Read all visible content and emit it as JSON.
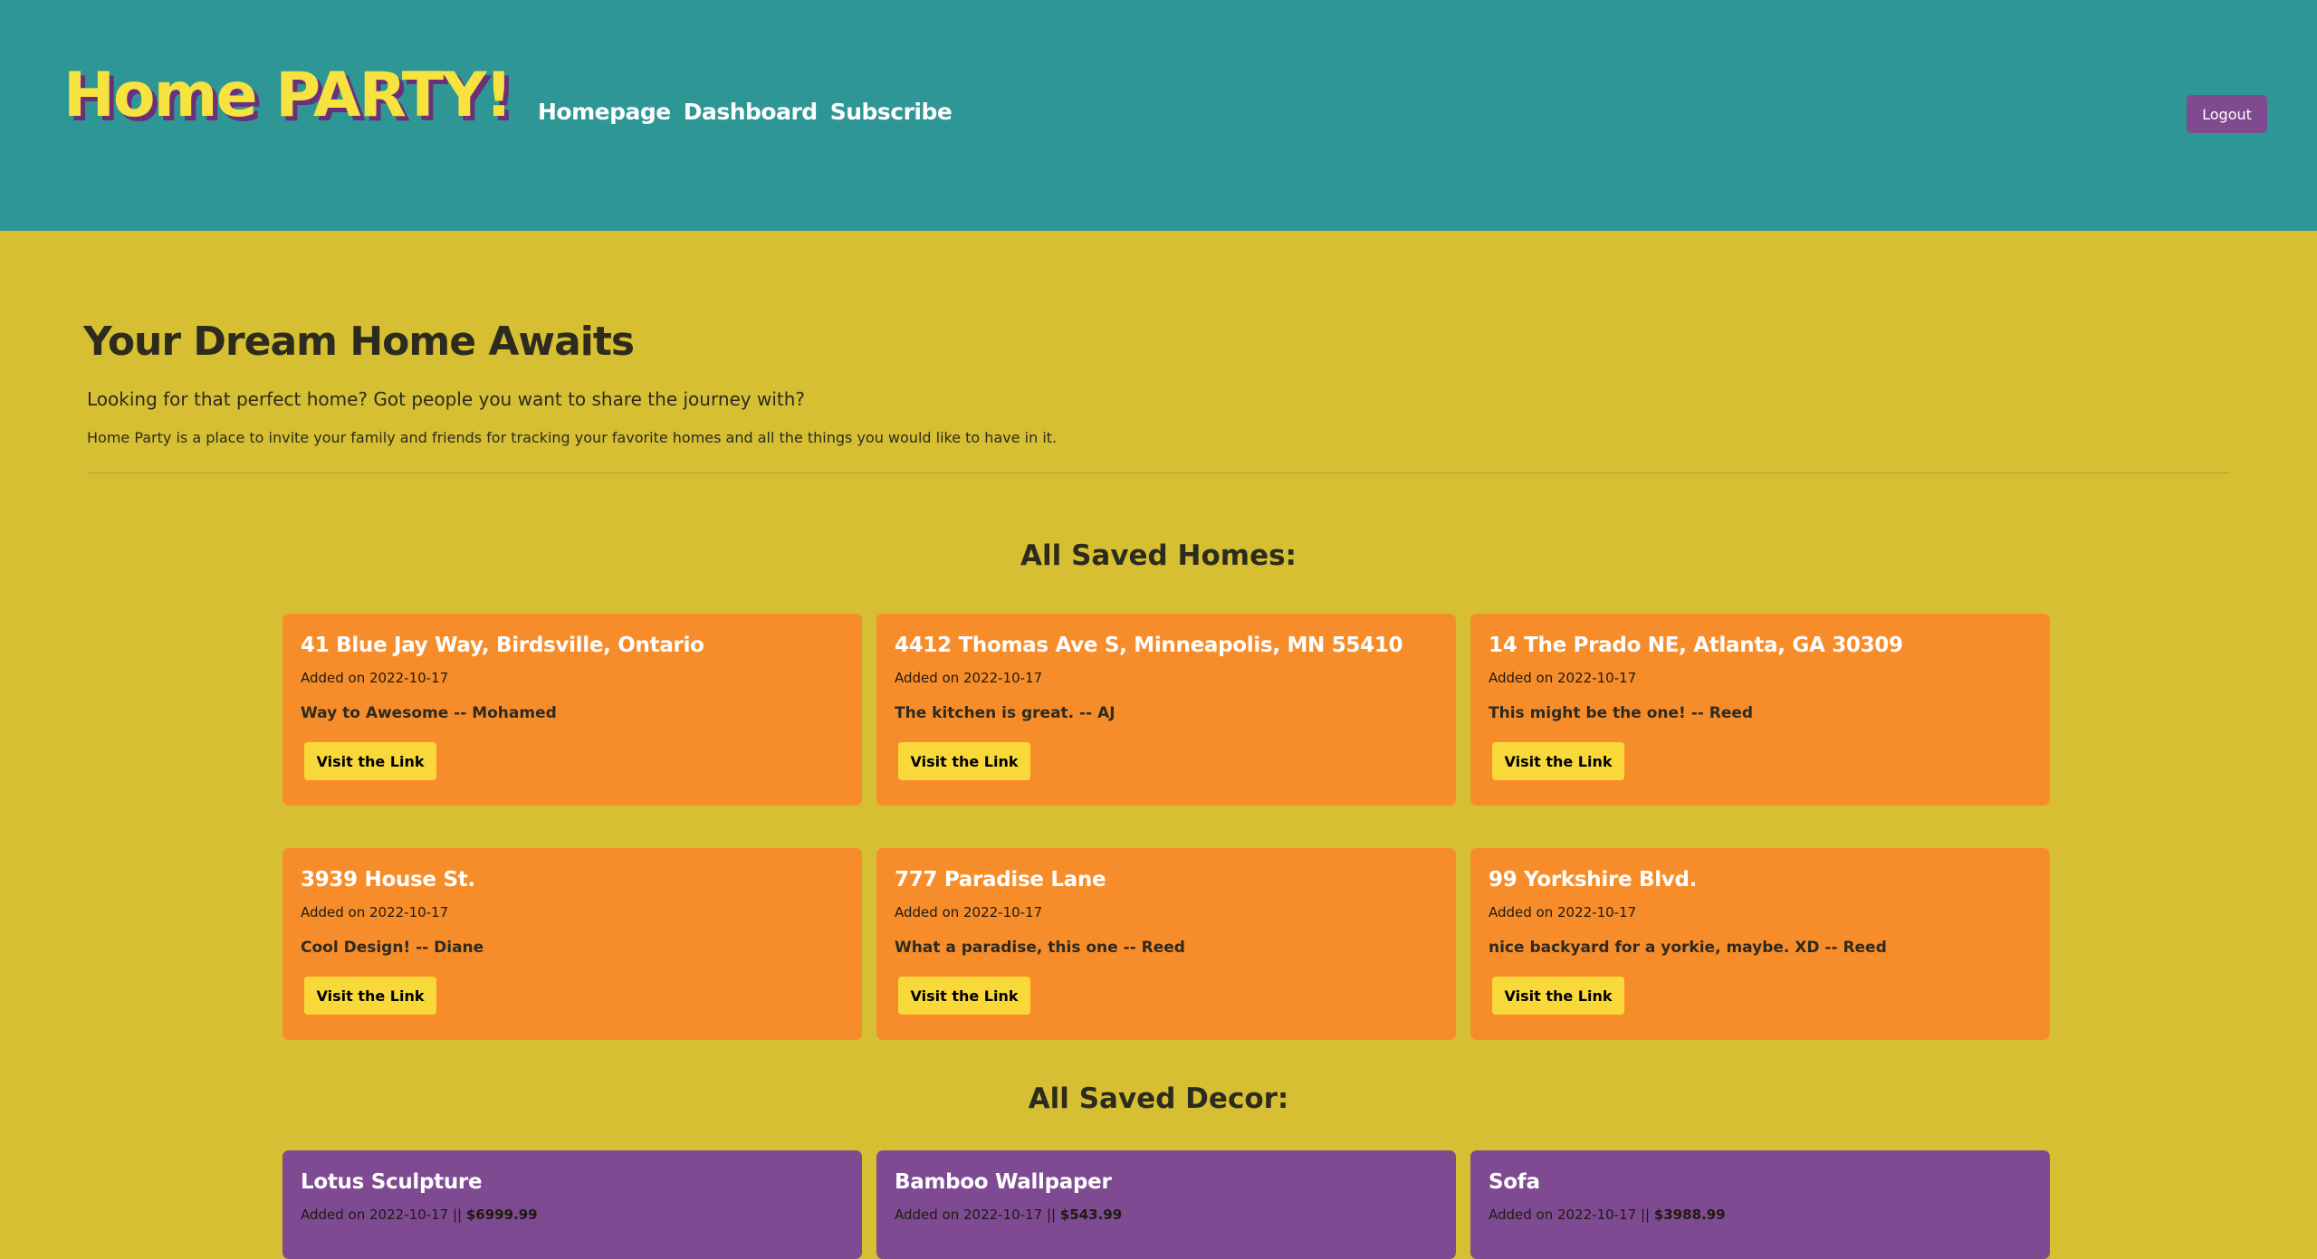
{
  "header": {
    "logo": "Home PARTY!",
    "nav": [
      "Homepage",
      "Dashboard",
      "Subscribe"
    ],
    "logout_label": "Logout"
  },
  "hero": {
    "title": "Your Dream Home Awaits",
    "lead": "Looking for that perfect home? Got people you want to share the journey with?",
    "body": "Home Party is a place to invite your family and friends for tracking your favorite homes and all the things you would like to have in it."
  },
  "homes": {
    "section_title": "All Saved Homes:",
    "items": [
      {
        "address": "41 Blue Jay Way, Birdsville, Ontario",
        "added": "Added on 2022-10-17",
        "note": "Way to Awesome -- Mohamed",
        "button": "Visit the Link"
      },
      {
        "address": "4412 Thomas Ave S, Minneapolis, MN 55410",
        "added": "Added on 2022-10-17",
        "note": "The kitchen is great. -- AJ",
        "button": "Visit the Link"
      },
      {
        "address": "14 The Prado NE, Atlanta, GA 30309",
        "added": "Added on 2022-10-17",
        "note": "This might be the one! -- Reed",
        "button": "Visit the Link"
      },
      {
        "address": "3939 House St.",
        "added": "Added on 2022-10-17",
        "note": "Cool Design! -- Diane",
        "button": "Visit the Link"
      },
      {
        "address": "777 Paradise Lane",
        "added": "Added on 2022-10-17",
        "note": "What a paradise, this one -- Reed",
        "button": "Visit the Link"
      },
      {
        "address": "99 Yorkshire Blvd.",
        "added": "Added on 2022-10-17",
        "note": "nice backyard for a yorkie, maybe. XD -- Reed",
        "button": "Visit the Link"
      }
    ]
  },
  "decor": {
    "section_title": "All Saved Decor:",
    "items": [
      {
        "name": "Lotus Sculpture",
        "added": "Added on 2022-10-17 || ",
        "price": "$6999.99"
      },
      {
        "name": "Bamboo Wallpaper",
        "added": "Added on 2022-10-17 || ",
        "price": "$543.99"
      },
      {
        "name": "Sofa",
        "added": "Added on 2022-10-17 || ",
        "price": "$3988.99"
      }
    ]
  },
  "colors": {
    "header_bg": "#2e9694",
    "page_bg": "#d6bf32",
    "home_card": "#f78d2a",
    "decor_card": "#7e4a92",
    "button": "#f9d93a",
    "logout": "#7f4a90"
  }
}
